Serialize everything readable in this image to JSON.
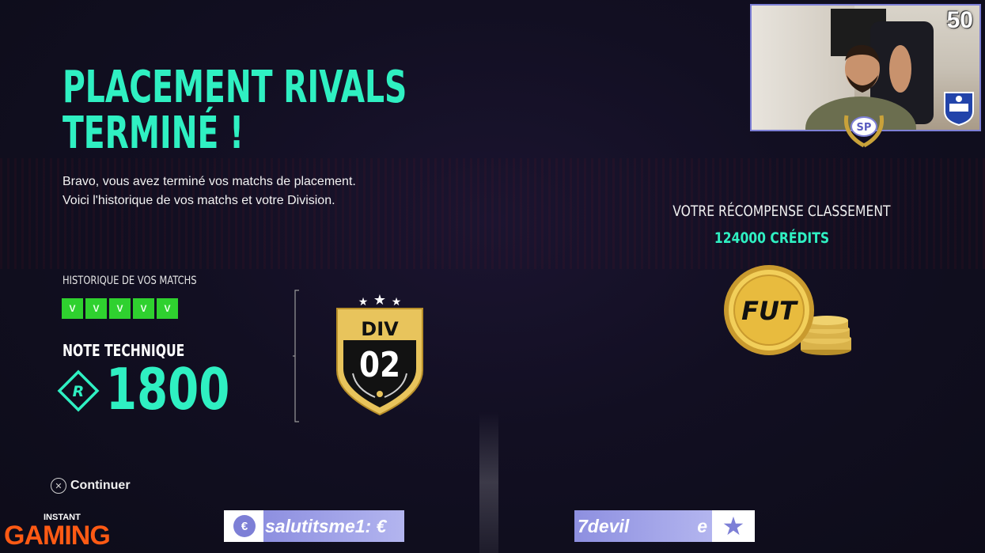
{
  "title": {
    "line1": "PLACEMENT RIVALS",
    "line2": "TERMINÉ !"
  },
  "subtitle": {
    "line1": "Bravo, vous avez terminé vos matchs de placement.",
    "line2": "Voici l'historique de vos matchs et votre Division."
  },
  "history": {
    "label": "HISTORIQUE DE VOS MATCHS",
    "results": [
      "V",
      "V",
      "V",
      "V",
      "V"
    ]
  },
  "technical": {
    "label": "NOTE TECHNIQUE",
    "icon_letter": "R",
    "rating": "1800"
  },
  "division": {
    "label": "DIV",
    "number": "02",
    "stars": 3
  },
  "reward": {
    "label": "VOTRE RÉCOMPENSE CLASSEMENT",
    "value": "124000 CRÉDITS",
    "coin_text": "FUT"
  },
  "continue": {
    "button_glyph": "✕",
    "label": "Continuer"
  },
  "stream": {
    "viewer_count": "50",
    "sponsor_small": "INSTANT",
    "sponsor_big": "GAMING",
    "alert1": {
      "icon": "€",
      "text": "salutitsme1: €"
    },
    "alert2": {
      "text": "7devil",
      "tail": "e"
    }
  },
  "colors": {
    "accent": "#2ff0c2",
    "win": "#2fd12f",
    "stream_purple": "#7d7fd6",
    "sponsor_orange": "#ff5a14",
    "gold": "#d9b24a"
  }
}
